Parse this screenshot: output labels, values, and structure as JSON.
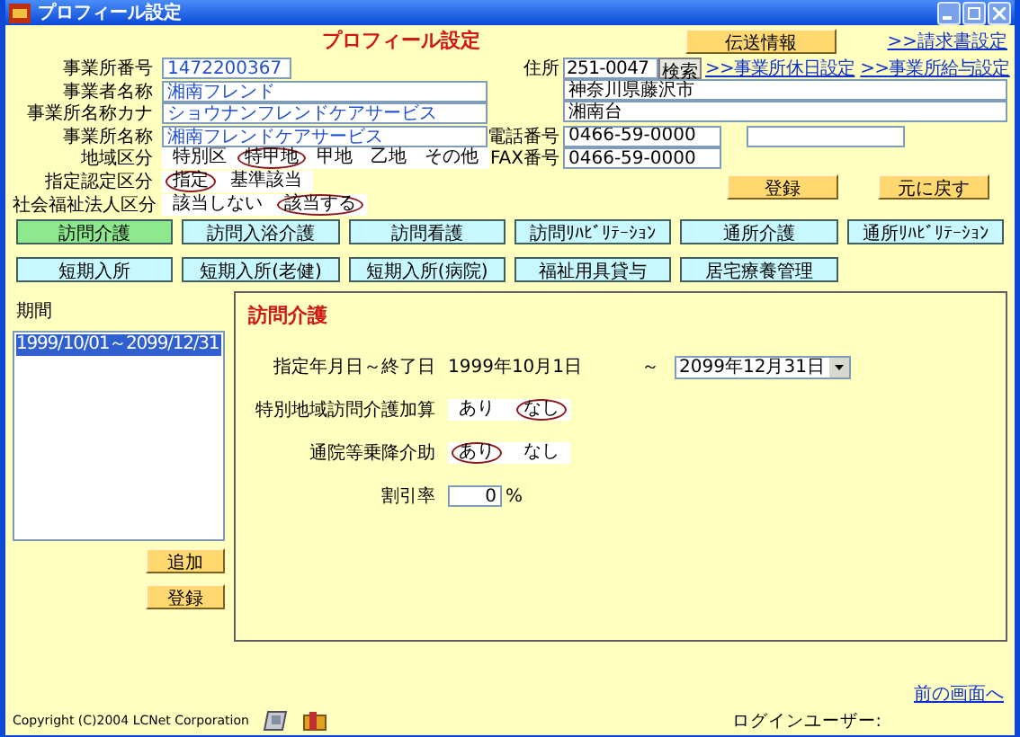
{
  "window": {
    "title": "プロフィール設定"
  },
  "header": {
    "title": "プロフィール設定",
    "transmit_button": "伝送情報",
    "billing_link": ">>請求書設定"
  },
  "office_fields": [
    {
      "label": "事業所番号",
      "value": "1472200367",
      "kind": "short"
    },
    {
      "label": "事業者名称",
      "value": "湘南フレンド",
      "kind": "long"
    },
    {
      "label": "事業所名称カナ",
      "value": "ショウナンフレンドケアサービス",
      "kind": "long"
    },
    {
      "label": "事業所名称",
      "value": "湘南フレンドケアサービス",
      "kind": "long"
    }
  ],
  "radio_groups": [
    {
      "label": "地域区分",
      "options": [
        {
          "label": "特別区",
          "selected": false
        },
        {
          "label": "特甲地",
          "selected": true
        },
        {
          "label": "甲地",
          "selected": false
        },
        {
          "label": "乙地",
          "selected": false
        },
        {
          "label": "その他",
          "selected": false
        }
      ]
    },
    {
      "label": "指定認定区分",
      "options": [
        {
          "label": "指定",
          "selected": true
        },
        {
          "label": "基準該当",
          "selected": false
        }
      ]
    },
    {
      "label": "社会福祉法人区分",
      "options": [
        {
          "label": "該当しない",
          "selected": false
        },
        {
          "label": "該当する",
          "selected": true
        }
      ]
    }
  ],
  "address": {
    "label": "住所",
    "postal": "251-0047",
    "search_button": "検索",
    "links": [
      ">>事業所休日設定",
      ">>事業所給与設定"
    ],
    "line1": "神奈川県藤沢市",
    "line2": "湘南台"
  },
  "phone": {
    "label": "電話番号",
    "value": "0466-59-0000"
  },
  "fax": {
    "label": "FAX番号",
    "value": "0466-59-0000"
  },
  "actions": [
    "登録",
    "元に戻す"
  ],
  "service_tabs": [
    [
      {
        "label": "訪問介護",
        "selected": true
      },
      {
        "label": "訪問入浴介護",
        "selected": false
      },
      {
        "label": "訪問看護",
        "selected": false
      },
      {
        "label": "訪問ﾘﾊﾋﾞﾘﾃｰｼｮﾝ",
        "selected": false
      },
      {
        "label": "通所介護",
        "selected": false
      },
      {
        "label": "通所ﾘﾊﾋﾞﾘﾃｰｼｮﾝ",
        "selected": false
      }
    ],
    [
      {
        "label": "短期入所",
        "selected": false
      },
      {
        "label": "短期入所(老健)",
        "selected": false
      },
      {
        "label": "短期入所(病院)",
        "selected": false
      },
      {
        "label": "福祉用具貸与",
        "selected": false
      },
      {
        "label": "居宅療養管理",
        "selected": false
      }
    ]
  ],
  "period": {
    "label": "期間",
    "items": [
      {
        "label": "1999/10/01～2099/12/31",
        "selected": true
      }
    ],
    "buttons": [
      "追加",
      "登録"
    ]
  },
  "detail": {
    "title": "訪問介護",
    "date_label": "指定年月日～終了日",
    "start": "1999年10月1日",
    "tilde": "～",
    "end": "2099年12月31日",
    "options": [
      {
        "label": "特別地域訪問介護加算",
        "choices": [
          {
            "label": "あり",
            "selected": false
          },
          {
            "label": "なし",
            "selected": true
          }
        ]
      },
      {
        "label": "通院等乗降介助",
        "choices": [
          {
            "label": "あり",
            "selected": true
          },
          {
            "label": "なし",
            "selected": false
          }
        ]
      }
    ],
    "discount_label": "割引率",
    "discount": "0",
    "unit": "%"
  },
  "back_link": "前の画面へ",
  "footer": {
    "copyright": "Copyright (C)2004 LCNet Corporation",
    "login_label": "ログインユーザー:"
  }
}
